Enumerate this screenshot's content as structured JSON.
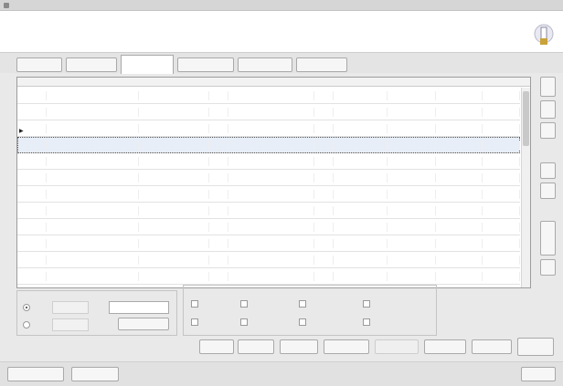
{
  "window": {
    "title": "",
    "title_extra": ""
  },
  "header": {
    "title": "",
    "subtitle": ""
  },
  "tabs": [
    {
      "label": ""
    },
    {
      "label": ""
    },
    {
      "label": "",
      "active": true
    },
    {
      "label": ""
    },
    {
      "label": ""
    },
    {
      "label": ""
    }
  ],
  "table": {
    "columns": [
      "",
      "",
      "",
      "",
      "",
      "",
      "",
      "",
      "",
      ""
    ],
    "selected_row": 3,
    "rows": [
      [
        "",
        "",
        "",
        "",
        "",
        "",
        "",
        "",
        "",
        ""
      ],
      [
        "",
        "",
        "",
        "",
        "",
        "",
        "",
        "",
        "",
        ""
      ],
      [
        "",
        "",
        "",
        "",
        "",
        "",
        "",
        "",
        "",
        ""
      ],
      [
        "",
        "",
        "",
        "",
        "",
        "",
        "",
        "",
        "",
        ""
      ],
      [
        "",
        "",
        "",
        "",
        "",
        "",
        "",
        "",
        "",
        ""
      ],
      [
        "",
        "",
        "",
        "",
        "",
        "",
        "",
        "",
        "",
        ""
      ],
      [
        "",
        "",
        "",
        "",
        "",
        "",
        "",
        "",
        "",
        ""
      ],
      [
        "",
        "",
        "",
        "",
        "",
        "",
        "",
        "",
        "",
        ""
      ],
      [
        "",
        "",
        "",
        "",
        "",
        "",
        "",
        "",
        "",
        ""
      ],
      [
        "",
        "",
        "",
        "",
        "",
        "",
        "",
        "",
        "",
        ""
      ],
      [
        "",
        "",
        "",
        "",
        "",
        "",
        "",
        "",
        "",
        ""
      ],
      [
        "",
        "",
        "",
        "",
        "",
        "",
        "",
        "",
        "",
        ""
      ]
    ]
  },
  "side_buttons": [
    {
      "label": ""
    },
    {
      "label": ""
    },
    {
      "label": ""
    },
    {
      "label": ""
    },
    {
      "label": ""
    },
    {
      "label": ""
    },
    {
      "label": ""
    }
  ],
  "filter": {
    "group1_title": "",
    "group2_title": "",
    "radio1_label": "",
    "radio2_label": "",
    "field_value": "",
    "sub_button": ""
  },
  "options": {
    "title": "",
    "checkboxes": [
      {
        "label": ""
      },
      {
        "label": ""
      },
      {
        "label": ""
      },
      {
        "label": ""
      },
      {
        "label": ""
      },
      {
        "label": ""
      },
      {
        "label": ""
      },
      {
        "label": ""
      }
    ]
  },
  "action_buttons": [
    {
      "label": ""
    },
    {
      "label": ""
    },
    {
      "label": ""
    },
    {
      "label": ""
    },
    {
      "label": ""
    },
    {
      "label": ""
    },
    {
      "label": ""
    },
    {
      "label": ""
    }
  ],
  "bottom_buttons": [
    {
      "label": ""
    },
    {
      "label": ""
    },
    {
      "label": ""
    }
  ],
  "colors": {
    "accent_blue": "#3b5ea6",
    "selection": "#e8eef7",
    "grid": "#d0d0d0"
  }
}
